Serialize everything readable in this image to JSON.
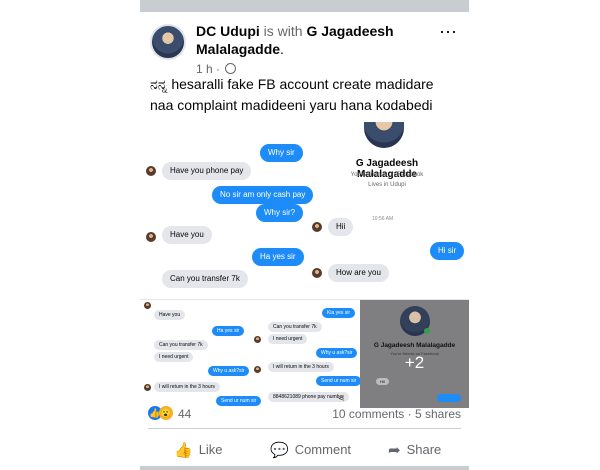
{
  "post": {
    "author": "DC Udupi",
    "with_word": "is with",
    "tagged": "G Jagadeesh Malalagadde",
    "period": ".",
    "time": "1 h",
    "time_sep": "·",
    "more_icon": "⋯",
    "caption": "ನನ್ನ hesaralli fake FB account create madidare naa complaint madideeni yaru hana kodabedi"
  },
  "screenshot": {
    "profile": {
      "name": "G Jagadeesh Malalagadde",
      "friends_text": "You're friends on Facebook",
      "lives_text": "Lives in Udupi",
      "timestamp": "10:56 AM"
    },
    "messages": [
      {
        "side": "out",
        "text": "Why sir"
      },
      {
        "side": "in",
        "text": "Have you phone pay"
      },
      {
        "side": "out",
        "text": "No sir am only cash pay"
      },
      {
        "side": "out",
        "text": "Why sir?"
      },
      {
        "side": "in",
        "text": "Have you"
      },
      {
        "side": "out",
        "text": "Ha yes sir"
      },
      {
        "side": "in",
        "text": "Can you transfer 7k"
      },
      {
        "side": "in",
        "text": "Hii"
      },
      {
        "side": "out",
        "text": "Hi sir"
      },
      {
        "side": "in",
        "text": "How are you"
      }
    ],
    "small_left": [
      "Have you",
      "Ha yes sir",
      "Can you transfer 7k",
      "I need urgent",
      "Why u ask?sir",
      "I will return in the 3 hours",
      "Send ur num sir"
    ],
    "small_mid": [
      "Kia yes sir",
      "Can you transfer 7k",
      "I need urgent",
      "Why u ask?sir",
      "I will return in the 3 hours",
      "Send ur num sir",
      "8848621089 phone pay number"
    ],
    "gray_pane": {
      "name": "G Jagadeesh Malalagadde",
      "sub": "You're friends on Facebook",
      "more": "+2",
      "hi": "Hii"
    }
  },
  "reactions": {
    "like_icon": "👍",
    "wow_icon": "😮",
    "count": "44",
    "comments": "10 comments",
    "sep": "·",
    "shares": "5 shares"
  },
  "actions": {
    "like": "Like",
    "comment": "Comment",
    "share": "Share",
    "like_icon": "👍",
    "comment_icon": "💬",
    "share_icon": "➦"
  }
}
